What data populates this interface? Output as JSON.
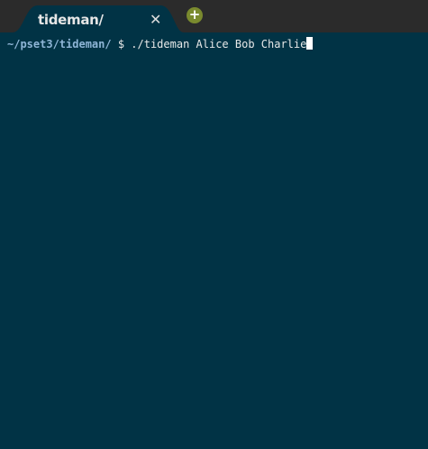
{
  "tab": {
    "title": "tideman/",
    "close_icon": "close-icon"
  },
  "add_tab_icon": "plus-icon",
  "terminal": {
    "prompt": "~/pset3/tideman/",
    "symbol": " $ ",
    "command": "./tideman Alice Bob Charlie"
  },
  "colors": {
    "background": "#013345",
    "tabbar": "#2b2b2b",
    "prompt": "#8fb5d6",
    "add_button": "#7a8a2e"
  }
}
